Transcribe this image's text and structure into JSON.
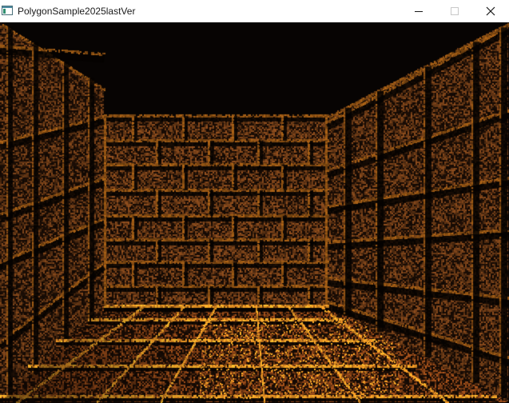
{
  "window": {
    "title": "PolygonSample2025lastVer",
    "icon": "app-window-icon",
    "controls": [
      "minimize-icon",
      "maximize-icon",
      "close-icon"
    ]
  },
  "scene": {
    "description_type": "3d-dungeon-corridor",
    "colors": {
      "background": "#070403",
      "wall_dark": "#3a1d0c",
      "wall_mid": "#6b3a16",
      "mortar": "#8a4f12",
      "floor": "#7a3c14",
      "floor_highlight": "#f29a25"
    }
  }
}
